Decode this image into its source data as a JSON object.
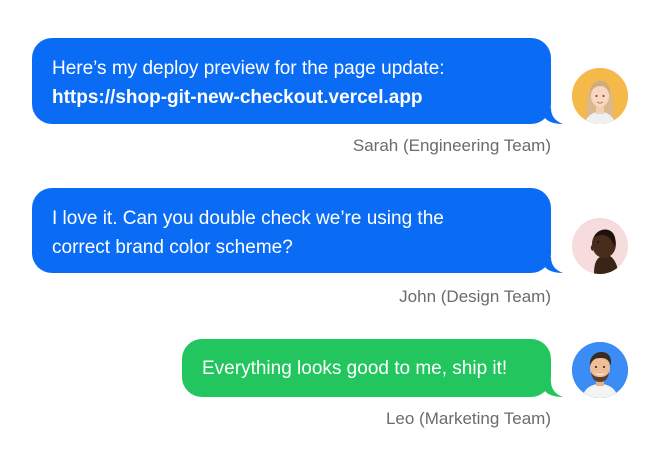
{
  "messages": [
    {
      "line1": "Here’s my deploy preview for the page update:",
      "line2": "https://shop-git-new-checkout.vercel.app",
      "sender": "Sarah (Engineering Team)",
      "bubble_color": "#0a6cf5",
      "avatar_icon": "woman-portrait-icon",
      "avatar_bg": "#f5b94a"
    },
    {
      "line1": "I love it. Can you double check we’re using the",
      "line2": "correct brand color scheme?",
      "sender": "John (Design Team)",
      "bubble_color": "#0a6cf5",
      "avatar_icon": "man-profile-portrait-icon",
      "avatar_bg": "#f6dcdc"
    },
    {
      "line1": "Everything looks good to me, ship it!",
      "sender": "Leo (Marketing Team)",
      "bubble_color": "#22c55e",
      "avatar_icon": "smiling-man-portrait-icon",
      "avatar_bg": "#3b8df5"
    }
  ]
}
